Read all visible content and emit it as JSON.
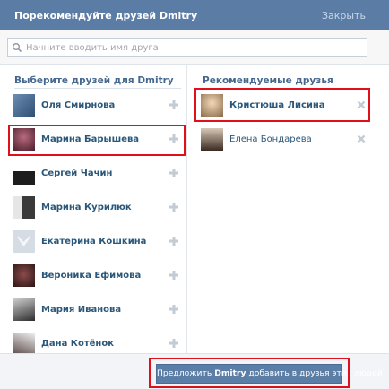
{
  "dialog": {
    "title": "Порекомендуйте друзей Dmitry",
    "close_label": "Закрыть"
  },
  "search": {
    "placeholder": "Начните вводить имя друга"
  },
  "left_column": {
    "header": "Выберите друзей для Dmitry",
    "items": [
      {
        "name": "Оля Смирнова"
      },
      {
        "name": "Марина Барышева"
      },
      {
        "name": "Сергей Чачин"
      },
      {
        "name": "Марина Курилюк"
      },
      {
        "name": "Екатерина Кошкина"
      },
      {
        "name": "Вероника Ефимова"
      },
      {
        "name": "Мария Иванова"
      },
      {
        "name": "Дана Котёнок"
      }
    ]
  },
  "right_column": {
    "header": "Рекомендуемые друзья",
    "items": [
      {
        "name": "Кристюша Лисина"
      },
      {
        "name": "Елена Бондарева"
      }
    ]
  },
  "footer": {
    "button_prefix": "Предложить ",
    "button_bold": "Dmitry",
    "button_suffix": " добавить в друзья этих людей"
  },
  "colors": {
    "titlebar": "#5b7ca5",
    "highlight": "#e0101a",
    "link": "#2b587a",
    "button": "#5b7ea6"
  }
}
